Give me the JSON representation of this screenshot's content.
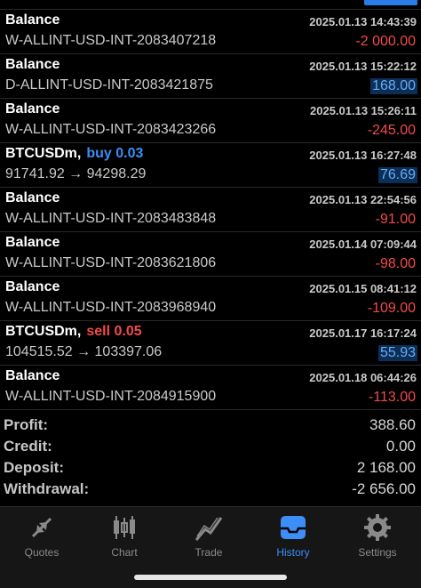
{
  "rows": [
    {
      "title": "Balance",
      "time": "2025.01.13 14:43:39",
      "desc": "W-ALLINT-USD-INT-2083407218",
      "amount": "-2 000.00"
    },
    {
      "title": "Balance",
      "time": "2025.01.13 15:22:12",
      "desc": "D-ALLINT-USD-INT-2083421875",
      "amount": "168.00"
    },
    {
      "title": "Balance",
      "time": "2025.01.13 15:26:11",
      "desc": "W-ALLINT-USD-INT-2083423266",
      "amount": "-245.00"
    },
    {
      "title": "BTCUSDm,",
      "side": "buy 0.03",
      "time": "2025.01.13 16:27:48",
      "desc": "91741.92 → 94298.29",
      "amount": "76.69"
    },
    {
      "title": "Balance",
      "time": "2025.01.13 22:54:56",
      "desc": "W-ALLINT-USD-INT-2083483848",
      "amount": "-91.00"
    },
    {
      "title": "Balance",
      "time": "2025.01.14 07:09:44",
      "desc": "W-ALLINT-USD-INT-2083621806",
      "amount": "-98.00"
    },
    {
      "title": "Balance",
      "time": "2025.01.15 08:41:12",
      "desc": "W-ALLINT-USD-INT-2083968940",
      "amount": "-109.00"
    },
    {
      "title": "BTCUSDm,",
      "side": "sell 0.05",
      "time": "2025.01.17 16:17:24",
      "desc": "104515.52 → 103397.06",
      "amount": "55.93"
    },
    {
      "title": "Balance",
      "time": "2025.01.18 06:44:26",
      "desc": "W-ALLINT-USD-INT-2084915900",
      "amount": "-113.00"
    }
  ],
  "summary": {
    "profit_label": "Profit:",
    "profit": "388.60",
    "credit_label": "Credit:",
    "credit": "0.00",
    "deposit_label": "Deposit:",
    "deposit": "2 168.00",
    "withdrawal_label": "Withdrawal:",
    "withdrawal": "-2 656.00"
  },
  "tabs": {
    "quotes": {
      "label": "Quotes",
      "icon": "quotes-arrows-icon"
    },
    "chart": {
      "label": "Chart",
      "icon": "candlestick-icon"
    },
    "trade": {
      "label": "Trade",
      "icon": "trend-line-icon"
    },
    "history": {
      "label": "History",
      "icon": "inbox-tray-icon",
      "active": true
    },
    "settings": {
      "label": "Settings",
      "icon": "gear-icon"
    }
  },
  "colors": {
    "negative": "#f24a4a",
    "positive": "#3e8ef7",
    "background": "#000000",
    "tabbar": "#161616",
    "active_tab": "#3e8ef7"
  }
}
